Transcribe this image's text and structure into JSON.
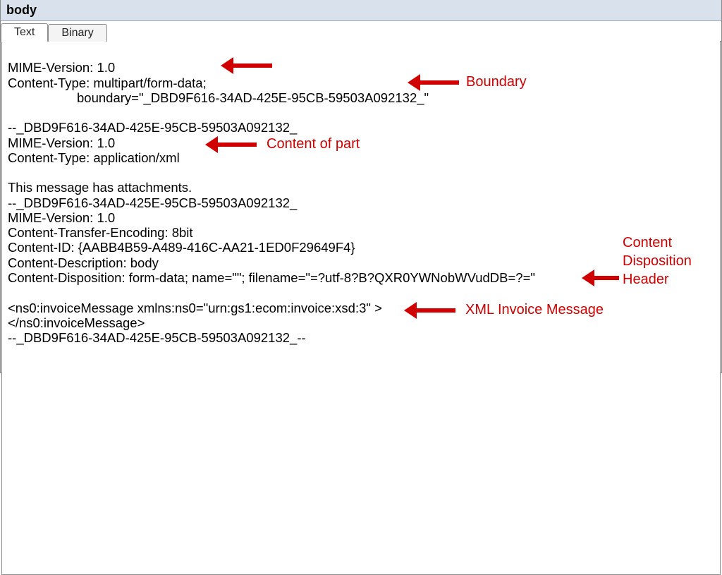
{
  "panel": {
    "title": "body"
  },
  "tabs": {
    "text": "Text",
    "binary": "Binary"
  },
  "body": {
    "l1": "MIME-Version: 1.0",
    "l2": "Content-Type: multipart/form-data;",
    "l3": "boundary=\"_DBD9F616-34AD-425E-95CB-59503A092132_\"",
    "l4": "",
    "l5": "--_DBD9F616-34AD-425E-95CB-59503A092132_",
    "l6": "MIME-Version: 1.0",
    "l7": "Content-Type: application/xml",
    "l8": "",
    "l9": "This message has attachments.",
    "l10": "--_DBD9F616-34AD-425E-95CB-59503A092132_",
    "l11": "MIME-Version: 1.0",
    "l12": "Content-Transfer-Encoding: 8bit",
    "l13": "Content-ID: {AABB4B59-A489-416C-AA21-1ED0F29649F4}",
    "l14": "Content-Description: body",
    "l15": "Content-Disposition: form-data; name=\"\"; filename=\"=?utf-8?B?QXR0YWNobWVudDB=?=\"",
    "l16": "",
    "l17": "<ns0:invoiceMessage xmlns:ns0=\"urn:gs1:ecom:invoice:xsd:3\" >",
    "l18": "</ns0:invoiceMessage>",
    "l19": "--_DBD9F616-34AD-425E-95CB-59503A092132_--"
  },
  "annotations": {
    "boundary": "Boundary",
    "content_of_part": "Content of part",
    "content_disposition_header": "Content\nDisposition\nHeader",
    "xml_invoice_message": "XML Invoice Message"
  }
}
